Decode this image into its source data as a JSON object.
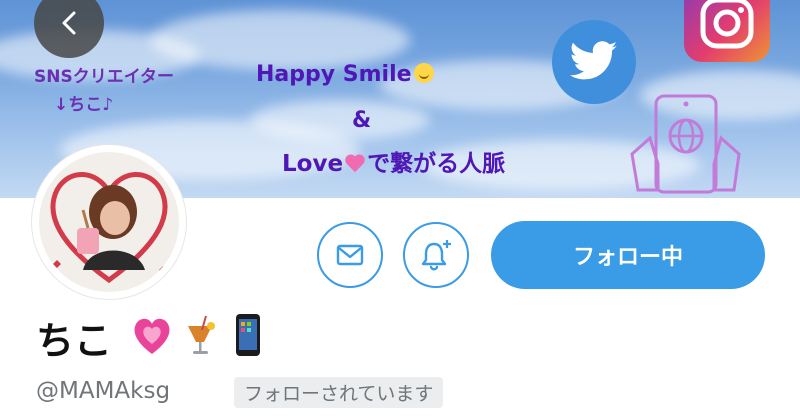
{
  "banner": {
    "creator_line": "SNSクリエイター",
    "chiko_line": "↓ちこ♪",
    "happy_smile": "Happy Smile",
    "ampersand": "&",
    "love_prefix": "Love",
    "love_suffix": "で繋がる人脈"
  },
  "icons": {
    "back": "chevron-left-icon",
    "twitter": "twitter-bird-icon",
    "instagram": "instagram-icon",
    "device": "phone-globe-icon",
    "mail": "mail-icon",
    "bell": "bell-plus-icon"
  },
  "actions": {
    "follow_label": "フォロー中"
  },
  "profile": {
    "display_name": "ちこ",
    "handle": "@MAMAksg",
    "follows_you": "フォローされています"
  },
  "colors": {
    "accent": "#3a9be6",
    "banner_text": "#4f17b5",
    "muted_text": "#707579"
  }
}
